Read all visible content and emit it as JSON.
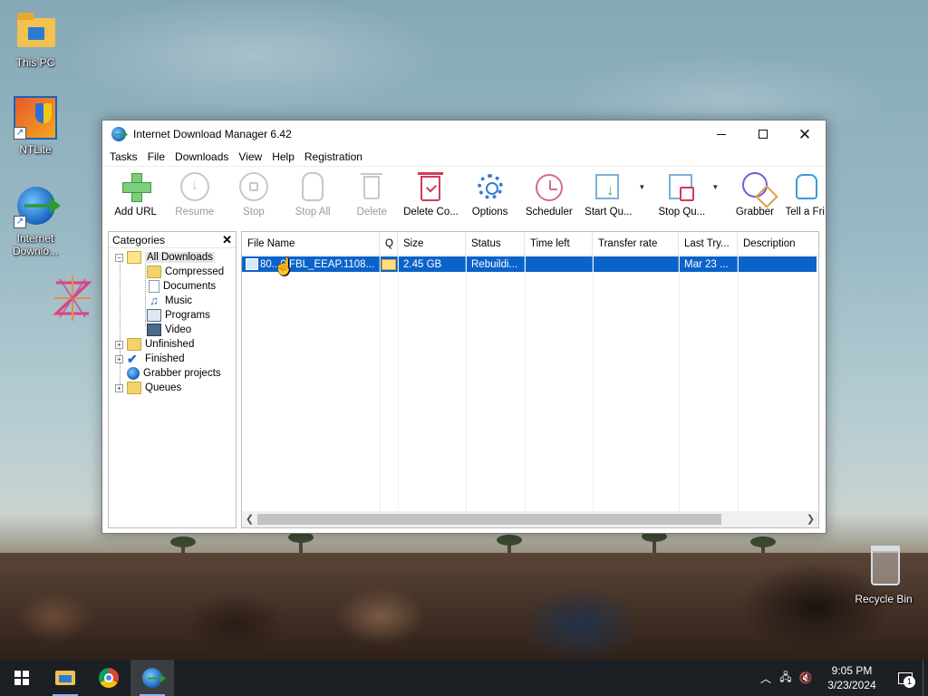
{
  "desktop": {
    "icons": [
      {
        "label": "This PC"
      },
      {
        "label": "NTLite"
      },
      {
        "label": "Internet Downlo..."
      },
      {
        "label": "Recycle Bin"
      }
    ]
  },
  "window": {
    "title": "Internet Download Manager 6.42",
    "menu": [
      "Tasks",
      "File",
      "Downloads",
      "View",
      "Help",
      "Registration"
    ],
    "toolbar": [
      {
        "label": "Add URL",
        "icon": "plus-icon",
        "enabled": true
      },
      {
        "label": "Resume",
        "icon": "resume-icon",
        "enabled": false
      },
      {
        "label": "Stop",
        "icon": "stop-icon",
        "enabled": false
      },
      {
        "label": "Stop All",
        "icon": "hand-icon",
        "enabled": false
      },
      {
        "label": "Delete",
        "icon": "trash-icon",
        "enabled": false
      },
      {
        "label": "Delete Co...",
        "icon": "delete-completed-icon",
        "enabled": true
      },
      {
        "label": "Options",
        "icon": "gear-icon",
        "enabled": true
      },
      {
        "label": "Scheduler",
        "icon": "clock-icon",
        "enabled": true
      },
      {
        "label": "Start Qu...",
        "icon": "start-queue-icon",
        "enabled": true
      },
      {
        "label": "Stop Qu...",
        "icon": "stop-queue-icon",
        "enabled": true
      },
      {
        "label": "Grabber",
        "icon": "grabber-icon",
        "enabled": true
      },
      {
        "label": "Tell a Fri",
        "icon": "thumbs-up-icon",
        "enabled": true
      }
    ],
    "categories": {
      "header": "Categories",
      "items": [
        {
          "label": "All Downloads"
        },
        {
          "label": "Compressed"
        },
        {
          "label": "Documents"
        },
        {
          "label": "Music"
        },
        {
          "label": "Programs"
        },
        {
          "label": "Video"
        },
        {
          "label": "Unfinished"
        },
        {
          "label": "Finished"
        },
        {
          "label": "Grabber projects"
        },
        {
          "label": "Queues"
        }
      ]
    },
    "list": {
      "columns": [
        "File Name",
        "Q",
        "Size",
        "Status",
        "Time left",
        "Transfer rate",
        "Last Try...",
        "Description"
      ],
      "rows": [
        {
          "file_name": "80...0.FBL_EEAP.1108...",
          "q": "",
          "size": "2.45  GB",
          "status": "Rebuildi...",
          "time_left": "",
          "transfer_rate": "",
          "last_try": "Mar 23 ...",
          "description": ""
        }
      ]
    }
  },
  "taskbar": {
    "time": "9:05 PM",
    "date": "3/23/2024",
    "notification_count": "1"
  },
  "colors": {
    "selection": "#0b63c9",
    "taskbar": "#1c1f24"
  }
}
